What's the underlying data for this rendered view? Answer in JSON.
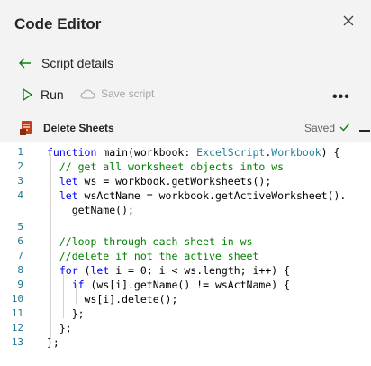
{
  "header": {
    "title": "Code Editor",
    "close_icon": "close-icon",
    "back_label": "Script details",
    "run_label": "Run",
    "save_label": "Save script",
    "more_label": "•••",
    "script_name": "Delete Sheets",
    "saved_label": "Saved"
  },
  "colors": {
    "keyword": "#0000ff",
    "comment": "#008000",
    "type": "#267f99",
    "run_icon": "#107c10",
    "script_icon": "#c43e1c"
  },
  "editor": {
    "line_numbers": [
      "1",
      "2",
      "3",
      "4",
      "5",
      "6",
      "7",
      "8",
      "9",
      "10",
      "11",
      "12",
      "13"
    ],
    "lines": [
      [
        {
          "t": "kw",
          "v": "function"
        },
        {
          "t": "tx",
          "v": " main(workbook: "
        },
        {
          "t": "ty",
          "v": "ExcelScript"
        },
        {
          "t": "tx",
          "v": "."
        },
        {
          "t": "ty",
          "v": "Workbook"
        },
        {
          "t": "tx",
          "v": ") {"
        }
      ],
      [
        {
          "t": "cm",
          "v": "  // get all worksheet objects into ws"
        }
      ],
      [
        {
          "t": "kw",
          "v": "  let"
        },
        {
          "t": "tx",
          "v": " ws = workbook.getWorksheets();"
        }
      ],
      [
        {
          "t": "kw",
          "v": "  let"
        },
        {
          "t": "tx",
          "v": " wsActName = workbook.getActiveWorksheet()."
        }
      ],
      [
        {
          "t": "tx",
          "v": "    getName();"
        }
      ],
      [
        {
          "t": "tx",
          "v": ""
        }
      ],
      [
        {
          "t": "cm",
          "v": "  //loop through each sheet in ws"
        }
      ],
      [
        {
          "t": "cm",
          "v": "  //delete if not the active sheet"
        }
      ],
      [
        {
          "t": "kw",
          "v": "  for"
        },
        {
          "t": "tx",
          "v": " ("
        },
        {
          "t": "kw",
          "v": "let"
        },
        {
          "t": "tx",
          "v": " i = 0; i < ws.length; i++) {"
        }
      ],
      [
        {
          "t": "kw",
          "v": "    if"
        },
        {
          "t": "tx",
          "v": " (ws[i].getName() != wsActName) {"
        }
      ],
      [
        {
          "t": "tx",
          "v": "      ws[i].delete();"
        }
      ],
      [
        {
          "t": "tx",
          "v": "    };"
        }
      ],
      [
        {
          "t": "tx",
          "v": "  };"
        }
      ],
      [
        {
          "t": "tx",
          "v": "};"
        }
      ]
    ]
  }
}
